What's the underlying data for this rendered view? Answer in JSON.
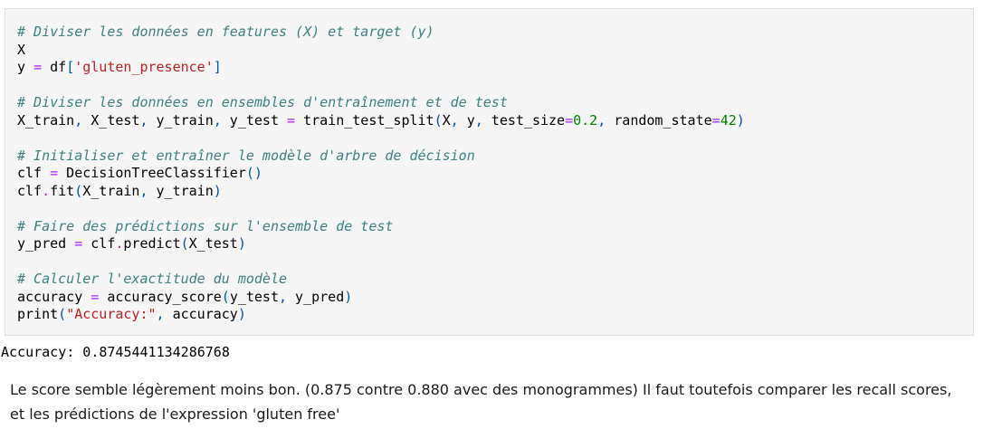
{
  "code_cell": {
    "lines": [
      [
        {
          "t": "c",
          "v": "# Diviser les données en features (X) et target (y)"
        }
      ],
      [
        {
          "t": "",
          "v": "X"
        }
      ],
      [
        {
          "t": "",
          "v": "y "
        },
        {
          "t": "o",
          "v": "="
        },
        {
          "t": "",
          "v": " df"
        },
        {
          "t": "p",
          "v": "["
        },
        {
          "t": "s",
          "v": "'gluten_presence'"
        },
        {
          "t": "p",
          "v": "]"
        }
      ],
      [],
      [
        {
          "t": "c",
          "v": "# Diviser les données en ensembles d'entraînement et de test"
        }
      ],
      [
        {
          "t": "",
          "v": "X_train"
        },
        {
          "t": "p",
          "v": ","
        },
        {
          "t": "",
          "v": " X_test"
        },
        {
          "t": "p",
          "v": ","
        },
        {
          "t": "",
          "v": " y_train"
        },
        {
          "t": "p",
          "v": ","
        },
        {
          "t": "",
          "v": " y_test "
        },
        {
          "t": "o",
          "v": "="
        },
        {
          "t": "",
          "v": " train_test_split"
        },
        {
          "t": "p",
          "v": "("
        },
        {
          "t": "",
          "v": "X"
        },
        {
          "t": "p",
          "v": ","
        },
        {
          "t": "",
          "v": " y"
        },
        {
          "t": "p",
          "v": ","
        },
        {
          "t": "",
          "v": " test_size"
        },
        {
          "t": "o",
          "v": "="
        },
        {
          "t": "n",
          "v": "0.2"
        },
        {
          "t": "p",
          "v": ","
        },
        {
          "t": "",
          "v": " random_state"
        },
        {
          "t": "o",
          "v": "="
        },
        {
          "t": "n",
          "v": "42"
        },
        {
          "t": "p",
          "v": ")"
        }
      ],
      [],
      [
        {
          "t": "c",
          "v": "# Initialiser et entraîner le modèle d'arbre de décision"
        }
      ],
      [
        {
          "t": "",
          "v": "clf "
        },
        {
          "t": "o",
          "v": "="
        },
        {
          "t": "",
          "v": " DecisionTreeClassifier"
        },
        {
          "t": "p",
          "v": "()"
        }
      ],
      [
        {
          "t": "",
          "v": "clf"
        },
        {
          "t": "o",
          "v": "."
        },
        {
          "t": "",
          "v": "fit"
        },
        {
          "t": "p",
          "v": "("
        },
        {
          "t": "",
          "v": "X_train"
        },
        {
          "t": "p",
          "v": ","
        },
        {
          "t": "",
          "v": " y_train"
        },
        {
          "t": "p",
          "v": ")"
        }
      ],
      [],
      [
        {
          "t": "c",
          "v": "# Faire des prédictions sur l'ensemble de test"
        }
      ],
      [
        {
          "t": "",
          "v": "y_pred "
        },
        {
          "t": "o",
          "v": "="
        },
        {
          "t": "",
          "v": " clf"
        },
        {
          "t": "o",
          "v": "."
        },
        {
          "t": "",
          "v": "predict"
        },
        {
          "t": "p",
          "v": "("
        },
        {
          "t": "",
          "v": "X_test"
        },
        {
          "t": "p",
          "v": ")"
        }
      ],
      [],
      [
        {
          "t": "c",
          "v": "# Calculer l'exactitude du modèle"
        }
      ],
      [
        {
          "t": "",
          "v": "accuracy "
        },
        {
          "t": "o",
          "v": "="
        },
        {
          "t": "",
          "v": " accuracy_score"
        },
        {
          "t": "p",
          "v": "("
        },
        {
          "t": "",
          "v": "y_test"
        },
        {
          "t": "p",
          "v": ","
        },
        {
          "t": "",
          "v": " y_pred"
        },
        {
          "t": "p",
          "v": ")"
        }
      ],
      [
        {
          "t": "",
          "v": "print"
        },
        {
          "t": "p",
          "v": "("
        },
        {
          "t": "s",
          "v": "\"Accuracy:\""
        },
        {
          "t": "p",
          "v": ","
        },
        {
          "t": "",
          "v": " accuracy"
        },
        {
          "t": "p",
          "v": ")"
        }
      ]
    ]
  },
  "output": {
    "text": "Accuracy: 0.8745441134286768"
  },
  "markdown": {
    "line1": "Le score semble légèrement moins bon. (0.875 contre 0.880 avec des monogrammes) Il faut toutefois comparer les recall scores,",
    "line2": "et les prédictions de l'expression 'gluten free'"
  },
  "colors": {
    "comment": "#408080",
    "string": "#ba2121",
    "number": "#008000",
    "operator": "#aa22ff",
    "punctuation": "#0055aa",
    "cell_background": "#f5f5f5"
  }
}
